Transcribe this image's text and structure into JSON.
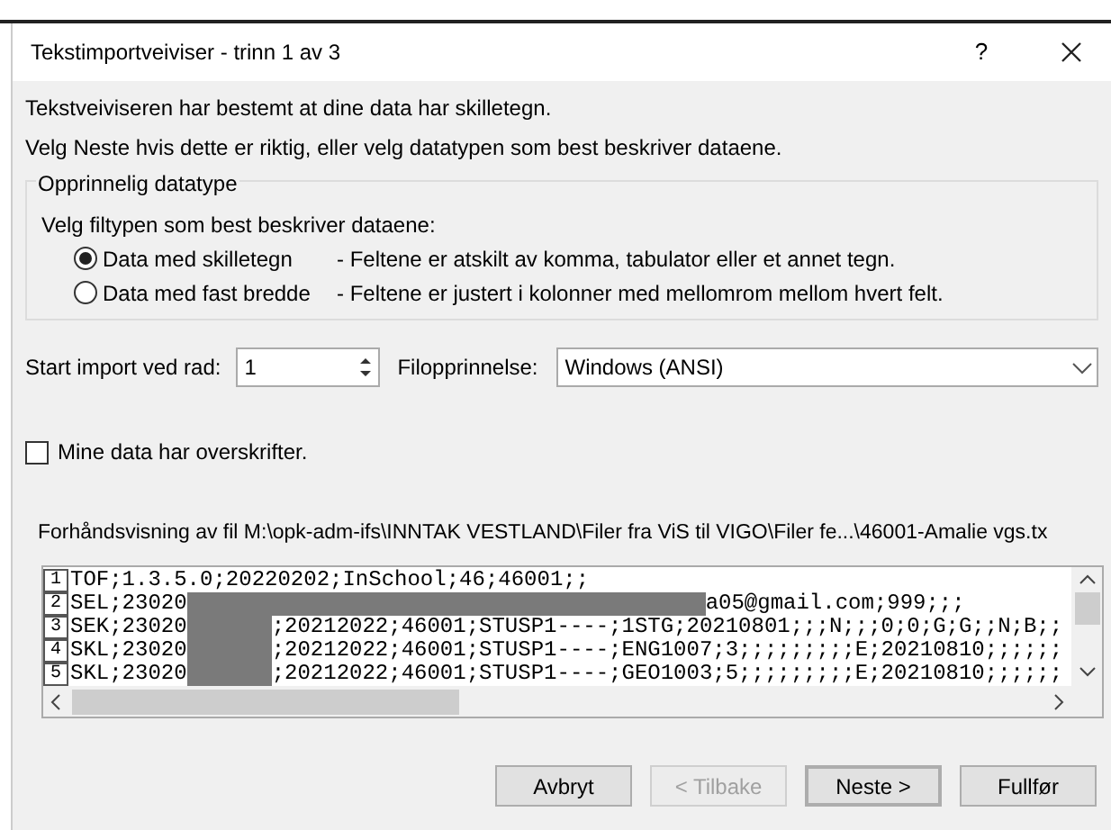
{
  "window": {
    "title": "Tekstimportveiviser - trinn 1 av 3",
    "help": "?"
  },
  "intro": [
    "Tekstveiviseren har bestemt at dine data har skilletegn.",
    "Velg Neste hvis dette er riktig, eller velg datatypen som best beskriver dataene."
  ],
  "group": {
    "legend": "Opprinnelig datatype",
    "prompt": "Velg filtypen som best beskriver dataene:",
    "options": [
      {
        "label": "Data med skilletegn",
        "description": "- Feltene er atskilt av komma, tabulator eller et annet tegn.",
        "selected": true
      },
      {
        "label": "Data med fast bredde",
        "description": "- Feltene er justert i kolonner med mellomrom mellom hvert felt.",
        "selected": false
      }
    ]
  },
  "start_row": {
    "label": "Start import ved rad:",
    "value": "1"
  },
  "origin": {
    "label": "Filopprinnelse:",
    "value": "Windows (ANSI)"
  },
  "headers": {
    "label": "Mine data har overskrifter.",
    "checked": false
  },
  "preview": {
    "caption": "Forhåndsvisning av fil M:\\opk-adm-ifs\\INNTAK VESTLAND\\Filer fra ViS til VIGO\\Filer fe...\\46001-Amalie vgs.tx",
    "rows": [
      {
        "number": "1",
        "before": "TOF;1.3.5.0;20220202;InSchool;46;46001;;",
        "kind": "plain",
        "after": ""
      },
      {
        "number": "2",
        "before": "SEL;23020",
        "kind": "long_redaction",
        "after": "a05@gmail.com;999;;;"
      },
      {
        "number": "3",
        "before": "SEK;23020",
        "kind": "short_redaction",
        "after": ";20212022;46001;STUSP1----;1STG;20210801;;;N;;;0;0;G;G;;N;B;;"
      },
      {
        "number": "4",
        "before": "SKL;23020",
        "kind": "short_redaction",
        "after": ";20212022;46001;STUSP1----;ENG1007;3;;;;;;;;;E;20210810;;;;;;"
      },
      {
        "number": "5",
        "before": "SKL;23020",
        "kind": "short_redaction",
        "after": ";20212022;46001;STUSP1----;GEO1003;5;;;;;;;;;E;20210810;;;;;;"
      }
    ]
  },
  "buttons": [
    {
      "label": "Avbryt",
      "disabled": false,
      "default": false
    },
    {
      "label": "< Tilbake",
      "disabled": true,
      "default": false
    },
    {
      "label": "Neste >",
      "disabled": false,
      "default": true
    },
    {
      "label": "Fullfør",
      "disabled": false,
      "default": false
    }
  ]
}
